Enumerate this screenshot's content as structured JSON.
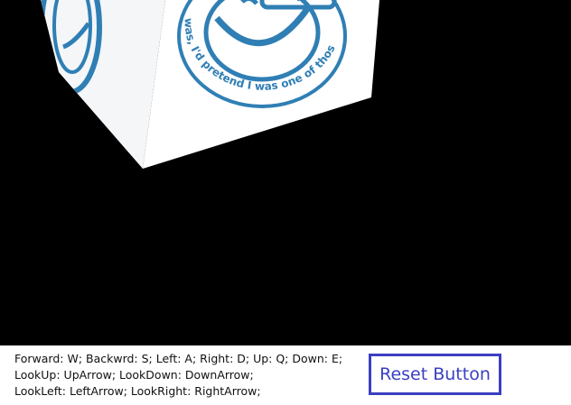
{
  "scene": {
    "logo_text": "was, I'd pretend I was one of thos",
    "colors": {
      "background": "#000000",
      "cube_face": "#ffffff",
      "cube_shade": "#e9eef2",
      "logo": "#2f7fb5"
    }
  },
  "controls": {
    "line1": "Forward: W; Backwrd: S; Left: A; Right: D; Up: Q; Down: E;",
    "line2": "LookUp: UpArrow; LookDown: DownArrow;",
    "line3": "LookLeft: LeftArrow; LookRight: RightArrow;"
  },
  "reset_button": {
    "label": "Reset Button",
    "color": "#3b3fc2"
  }
}
